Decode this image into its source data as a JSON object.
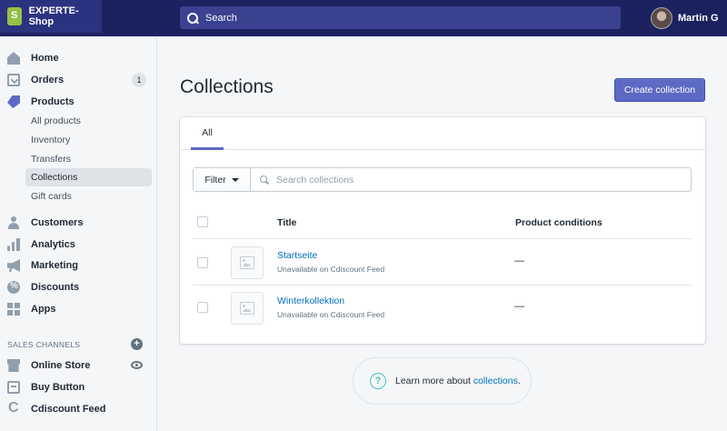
{
  "topbar": {
    "store_name": "EXPERTE-Shop",
    "search_label": "Search",
    "user_name": "Martin G"
  },
  "sidebar": {
    "items": [
      {
        "label": "Home",
        "icon": "home-icon"
      },
      {
        "label": "Orders",
        "icon": "orders-icon",
        "badge": "1"
      },
      {
        "label": "Products",
        "icon": "tag-icon"
      },
      {
        "label": "Customers",
        "icon": "customers-icon"
      },
      {
        "label": "Analytics",
        "icon": "analytics-icon"
      },
      {
        "label": "Marketing",
        "icon": "megaphone-icon"
      },
      {
        "label": "Discounts",
        "icon": "discounts-icon"
      },
      {
        "label": "Apps",
        "icon": "apps-icon"
      }
    ],
    "product_subitems": [
      "All products",
      "Inventory",
      "Transfers",
      "Collections",
      "Gift cards"
    ],
    "active_subitem": "Collections",
    "sales_channels_label": "SALES CHANNELS",
    "channels": [
      {
        "label": "Online Store",
        "icon": "store-icon"
      },
      {
        "label": "Buy Button",
        "icon": "buy-button-icon"
      },
      {
        "label": "Cdiscount Feed",
        "icon": "cdiscount-icon"
      }
    ]
  },
  "main": {
    "title": "Collections",
    "create_button": "Create collection",
    "tabs": [
      {
        "label": "All"
      }
    ],
    "filter_label": "Filter",
    "search_placeholder": "Search collections",
    "columns": [
      "Title",
      "Product conditions"
    ],
    "rows": [
      {
        "title": "Startseite",
        "subtitle": "Unavailable on Cdiscount Feed",
        "conditions": "—"
      },
      {
        "title": "Winterkollektion",
        "subtitle": "Unavailable on Cdiscount Feed",
        "conditions": "—"
      }
    ],
    "learn_more_prefix": "Learn more about ",
    "learn_more_link": "collections",
    "learn_more_suffix": "."
  },
  "colors": {
    "topbar": "#1c2260",
    "accent": "#5c6ac4",
    "link": "#006fbb"
  }
}
